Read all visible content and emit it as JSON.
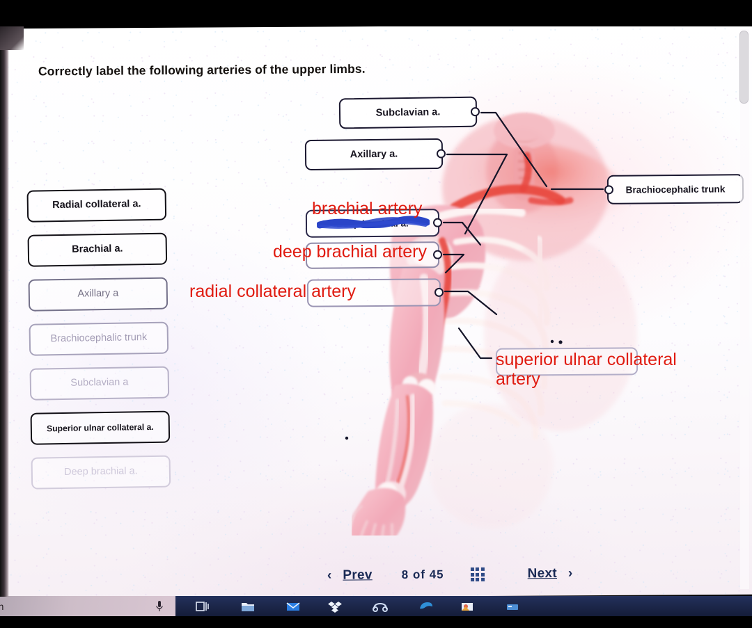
{
  "headline": "Correctly label the following arteries of the upper limbs.",
  "word_bank": [
    {
      "label": "Radial collateral a.",
      "state": "solid"
    },
    {
      "label": "Brachial a.",
      "state": "solid"
    },
    {
      "label": "Axillary a",
      "state": "faded-1"
    },
    {
      "label": "Brachiocephalic trunk",
      "state": "faded-2"
    },
    {
      "label": "Subclavian a",
      "state": "faded-3"
    },
    {
      "label": "Superior ulnar collateral a.",
      "state": "solid-small"
    },
    {
      "label": "Deep brachial a.",
      "state": "faded-4"
    }
  ],
  "answer_boxes": [
    {
      "name": "subclavian",
      "label": "Subclavian a.",
      "connector": "right"
    },
    {
      "name": "axillary",
      "label": "Axillary a.",
      "connector": "right"
    },
    {
      "name": "brachiocephalic",
      "label": "Brachiocephalic trunk",
      "connector": "left"
    },
    {
      "name": "deep-brachial",
      "label": "Deep brachial a.",
      "connector": "right",
      "struck_out": true
    },
    {
      "name": "empty-1",
      "label": "",
      "connector": "right"
    },
    {
      "name": "empty-2",
      "label": "",
      "connector": "right"
    },
    {
      "name": "empty-3",
      "label": "",
      "connector": "none"
    }
  ],
  "annotations": [
    {
      "name": "brachial-artery",
      "text": "brachial artery",
      "color": "#e01b10"
    },
    {
      "name": "deep-brachial-artery",
      "text": "deep brachial artery",
      "color": "#e01b10"
    },
    {
      "name": "radial-collateral-artery",
      "text": "radial collateral artery",
      "color": "#e01b10"
    },
    {
      "name": "superior-ulnar-collateral-artery",
      "text": "superior ulnar collateral\nartery",
      "color": "#e01b10"
    }
  ],
  "nav": {
    "prev_label": "Prev",
    "next_label": "Next",
    "prev_chevron": "‹",
    "next_chevron": "›",
    "counter": "8 of 45",
    "current_page": 8,
    "total_pages": 45,
    "grid_icon": "grid-icon"
  },
  "taskbar": {
    "search_text": "rch",
    "mic_icon": "microphone-icon",
    "apps": [
      "task-view-icon",
      "file-explorer-icon",
      "mail-icon",
      "dropbox-icon",
      "messenger-icon",
      "edge-icon",
      "photos-icon",
      "store-icon"
    ]
  },
  "colors": {
    "annotation_red": "#e01b10",
    "scribble_blue": "#2a45c8",
    "box_border": "#1b1830",
    "nav_blue": "#1a2a55",
    "taskbar": "#1b2547"
  }
}
